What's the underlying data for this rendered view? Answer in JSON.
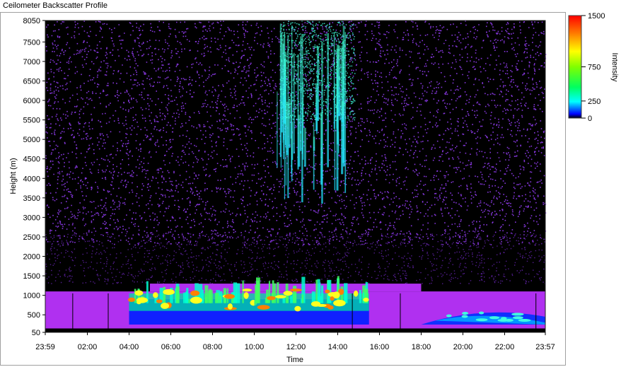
{
  "window": {
    "title": "Ceilometer Backscatter Profile"
  },
  "chart_data": {
    "type": "heatmap",
    "title": "Ceilometer Backscatter Profile",
    "xlabel": "Time",
    "ylabel": "Height (m)",
    "x_tick_labels": [
      "23:59",
      "02:00",
      "04:00",
      "06:00",
      "08:00",
      "10:00",
      "12:00",
      "14:00",
      "16:00",
      "18:00",
      "20:00",
      "22:00",
      "23:57"
    ],
    "x_tick_hours": [
      -0.0167,
      2,
      4,
      6,
      8,
      10,
      12,
      14,
      16,
      18,
      20,
      22,
      23.95
    ],
    "xlim": [
      -0.0167,
      23.95
    ],
    "y_ticks": [
      50,
      500,
      1000,
      1500,
      2000,
      2500,
      3000,
      3500,
      4000,
      4500,
      5000,
      5500,
      6000,
      6500,
      7000,
      7500,
      8050
    ],
    "ylim": [
      50,
      8050
    ],
    "colorbar": {
      "label": "Intensity",
      "tick_values": [
        1500,
        750,
        250,
        0
      ],
      "tick_labels": [
        "1500",
        "750",
        "250",
        "0"
      ],
      "range": [
        0,
        1500
      ],
      "colors": [
        "#000000",
        "#0000ff",
        "#00ff80",
        "#80ff00",
        "#ffff00",
        "#ff8000",
        "#ff0000"
      ]
    },
    "layers": [
      {
        "name": "low_cloud_base",
        "x_start": 0,
        "x_end": 23.95,
        "height_top": 1100,
        "intensity": 120
      },
      {
        "name": "morning_plume",
        "x_start": 4,
        "x_end": 10,
        "height_top": 1400,
        "intensity": 600
      },
      {
        "name": "midday_plume",
        "x_start": 10,
        "x_end": 15.5,
        "height_top": 1500,
        "intensity": 700
      },
      {
        "name": "high_cirrus",
        "x_start": 11,
        "x_end": 14.5,
        "height_bottom": 3300,
        "height_top": 8050,
        "intensity": 300
      },
      {
        "name": "evening_layer",
        "x_start": 18,
        "x_end": 23.95,
        "height_top": 750,
        "intensity": 350
      }
    ],
    "grid": false,
    "legend": "right"
  }
}
